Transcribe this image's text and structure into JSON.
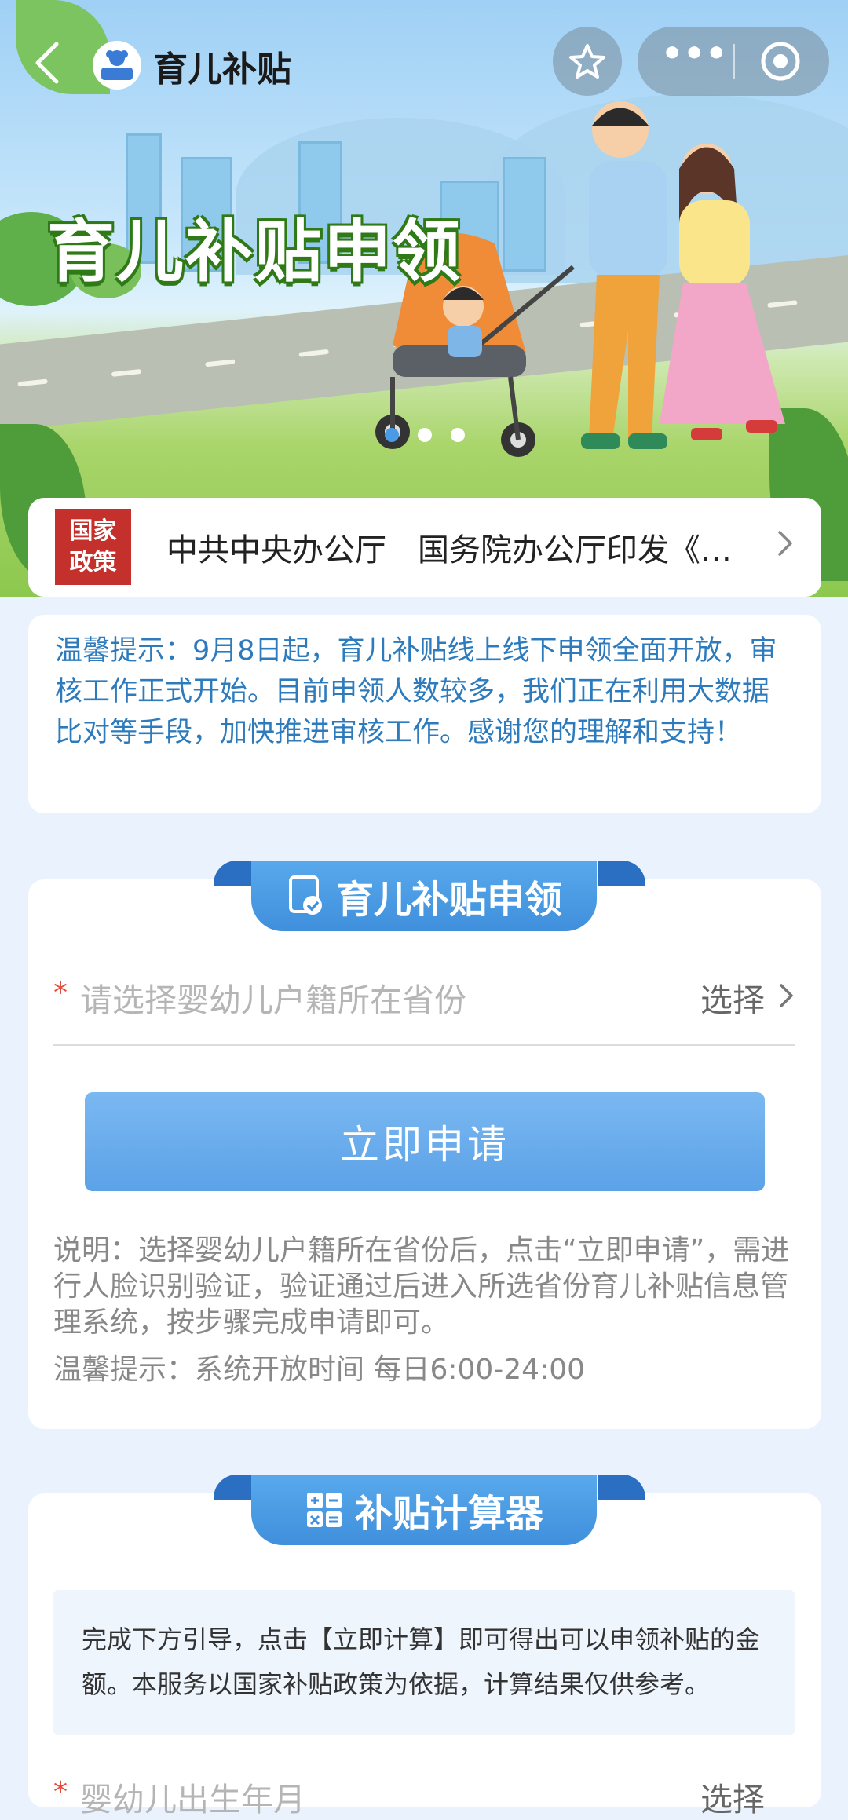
{
  "nav": {
    "title": "育儿补贴",
    "logo_text": "育儿补贴",
    "back_icon": "back-arrow-icon",
    "favorite_icon": "star-icon",
    "more_icon": "more-dots-icon",
    "close_icon": "target-circle-icon"
  },
  "banner": {
    "title": "育儿补贴申领",
    "page_dots": 3,
    "active_dot": 1
  },
  "policy": {
    "badge": "国家政策",
    "text": "中共中央办公厅　国务院办公厅印发《…"
  },
  "notice": {
    "text": "温馨提示：9月8日起，育儿补贴线上线下申领全面开放，审核工作正式开始。目前申领人数较多，我们正在利用大数据比对等手段，加快推进审核工作。感谢您的理解和支持！"
  },
  "apply": {
    "section_title": "育儿补贴申领",
    "required_mark": "*",
    "province_placeholder": "请选择婴幼儿户籍所在省份",
    "choose_label": "选择",
    "submit_label": "立即申请",
    "description": "说明：选择婴幼儿户籍所在省份后，点击“立即申请”，需进行人脸识别验证，验证通过后进入所选省份育儿补贴信息管理系统，按步骤完成申请即可。",
    "tip": "温馨提示：系统开放时间 每日6:00-24:00"
  },
  "calculator": {
    "section_title": "补贴计算器",
    "info": "完成下方引导，点击【立即计算】即可得出可以申领补贴的金额。本服务以国家补贴政策为依据，计算结果仅供参考。",
    "required_mark": "*",
    "birth_label": "婴幼儿出生年月",
    "choose_label": "选择"
  },
  "colors": {
    "accent_blue": "#4a9be6",
    "notice_text": "#2d7bbd",
    "policy_badge": "#c4312c",
    "required": "#e44b3a"
  }
}
